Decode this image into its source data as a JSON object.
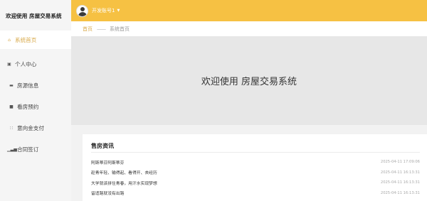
{
  "app": {
    "title": "欢迎使用 房屋交易系统"
  },
  "header": {
    "username": "开发账号1"
  },
  "sidebar": {
    "items": [
      {
        "label": "系统首页",
        "icon": "home-icon"
      },
      {
        "label": "个人中心",
        "icon": "user-icon"
      },
      {
        "label": "房源信息",
        "icon": "building-icon"
      },
      {
        "label": "看房预约",
        "icon": "calendar-icon"
      },
      {
        "label": "意向金支付",
        "icon": "grid-icon"
      },
      {
        "label": "合同签订",
        "icon": "chart-icon"
      }
    ]
  },
  "breadcrumb": {
    "home": "首页",
    "separator": "——",
    "current": "系统首页"
  },
  "banner": {
    "text": "欢迎使用 房屋交易系统"
  },
  "news": {
    "title": "售房资讯",
    "items": [
      {
        "title": "阿斯蒂芬阿斯蒂芬",
        "date": "2025-04-11 17:09:06"
      },
      {
        "title": "趁青年轻、输得起、看得开、去经历",
        "date": "2025-04-11 16:13:31"
      },
      {
        "title": "大学就该拼住青春，用汗水实现梦想",
        "date": "2025-04-11 16:13:31"
      },
      {
        "title": "留适路就没有出路",
        "date": "2025-04-11 16:13:31"
      }
    ]
  },
  "colors": {
    "accent": "#f6c143",
    "highlight": "#d8a94a",
    "banner_bg": "#e7e7e7"
  }
}
